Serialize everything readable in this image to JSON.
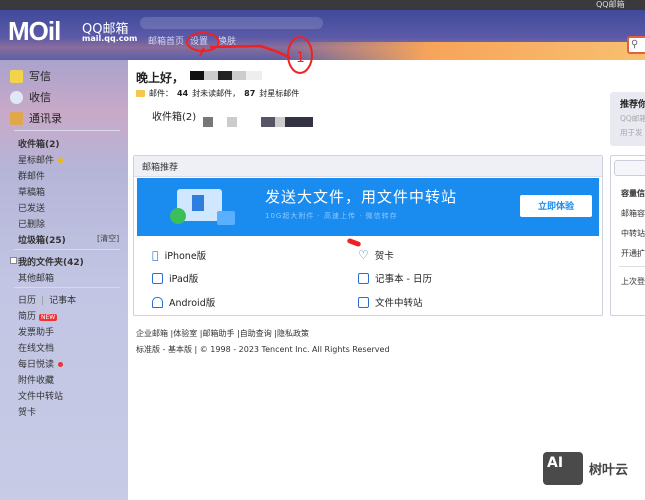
{
  "browser": {
    "tab_title": "QQ邮箱"
  },
  "header": {
    "logo_text": "MOil",
    "logo_cn": "QQ邮箱",
    "logo_url": "mail.qq.com",
    "nav": [
      "邮箱首页",
      "设置",
      "换肤"
    ],
    "search_icon": "search-icon"
  },
  "sidebar": {
    "actions": [
      {
        "label": "写信",
        "icon": "compose-icon"
      },
      {
        "label": "收信",
        "icon": "inbox-icon"
      },
      {
        "label": "通讯录",
        "icon": "contacts-icon"
      }
    ],
    "folders": [
      {
        "label": "收件箱(2)",
        "bold": true
      },
      {
        "label": "星标邮件",
        "dot": "#f5b800"
      },
      {
        "label": "群邮件"
      },
      {
        "label": "草稿箱"
      },
      {
        "label": "已发送"
      },
      {
        "label": "已删除"
      },
      {
        "label": "垃圾箱(25)",
        "bold": true,
        "action": "[清空]"
      }
    ],
    "my_folders": "我的文件夹(42)",
    "other_mailbox": "其他邮箱",
    "tools": {
      "calendar": "日历",
      "notepad": "记事本",
      "resume": "简历",
      "new_badge": "NEW",
      "items": [
        "发票助手",
        "在线文档",
        "每日悦读",
        "附件收藏",
        "文件中转站",
        "贺卡"
      ],
      "reading_dot": "#e33"
    }
  },
  "main": {
    "greeting": "晚上好，",
    "stats_prefix": "邮件：",
    "unread_count": "44",
    "unread_label": "封未读邮件，",
    "starred_count": "87",
    "starred_label": "封星标邮件",
    "inbox_label": "收件箱(2)",
    "recommend_card": {
      "title": "推荐你",
      "line1": "QQ邮箱",
      "line2": "用于发"
    },
    "panel": {
      "title": "邮箱推荐",
      "banner": {
        "title": "发送大文件，用文件中转站",
        "subtitle": "10G超大附件 · 高速上传 · 微信转存",
        "button": "立即体验",
        "color": "#1a8cf0"
      },
      "links_left": [
        {
          "label": "iPhone版",
          "icon": "apple-icon"
        },
        {
          "label": "iPad版",
          "icon": "ipad-icon"
        },
        {
          "label": "Android版",
          "icon": "android-icon"
        }
      ],
      "links_right": [
        {
          "label": "贺卡",
          "icon": "heart-icon"
        },
        {
          "label": "记事本 - 日历",
          "icon": "calendar-icon"
        },
        {
          "label": "文件中转站",
          "icon": "file-transfer-icon"
        }
      ]
    },
    "right_panel": {
      "items": [
        "容量信",
        "邮箱容",
        "中转站",
        "开通扩",
        "上次登"
      ]
    },
    "footer": {
      "links": [
        "企业邮箱",
        "体验室",
        "邮箱助手",
        "自助查询",
        "隐私政策"
      ],
      "versions": "标准版 - 基本版",
      "copyright": "© 1998 - 2023 Tencent Inc. All Rights Reserved"
    }
  },
  "annotation": {
    "number": "1"
  },
  "watermark": {
    "badge": "AI",
    "text": "树叶云"
  }
}
